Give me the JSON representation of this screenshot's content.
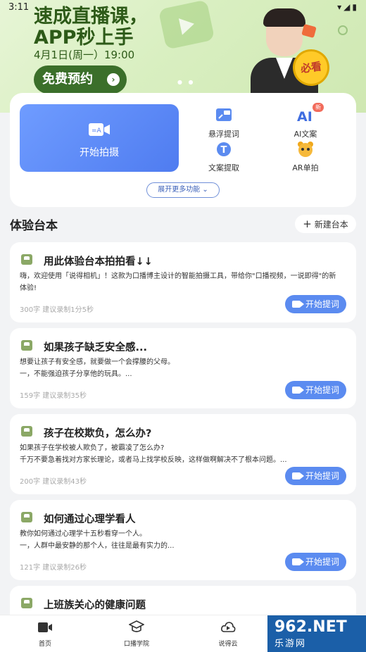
{
  "status_bar": {
    "time": "3:11"
  },
  "banner": {
    "title_line1": "速成直播课，",
    "title_line2": "APP秒上手",
    "date": "4月1日(周一）19:00",
    "reserve_label": "免费预约",
    "badge": "必看"
  },
  "tools": {
    "shoot_label": "开始拍摄",
    "floating_prompter": "悬浮提词",
    "ai_copy": "AI文案",
    "ai_badge": "新",
    "text_extract": "文案提取",
    "ar_shoot": "AR单拍",
    "expand": "展开更多功能"
  },
  "section": {
    "title": "体验台本",
    "new_button": "新建台本"
  },
  "scripts": [
    {
      "title": "用此体验台本拍拍看↓↓",
      "line1": "嗨，欢迎使用「说得相机」！这款为口播博主设计的智能拍摄工具，带给你\"口播视频，一说即得\"的新",
      "line2": "体验!",
      "meta": "300字 建议录制1分5秒",
      "button": "开始提词"
    },
    {
      "title": "如果孩子缺乏安全感...",
      "line1": "想要让孩子有安全感，就要做一个会撑腰的父母。",
      "line2": "一，不能强迫孩子分享他的玩具。...",
      "meta": "159字 建议录制35秒",
      "button": "开始提词"
    },
    {
      "title": "孩子在校欺负，怎么办?",
      "line1": "如果孩子在学校被人欺负了，被霸凌了怎么办?",
      "line2": "千万不要急着找对方家长理论，或者马上找学校反映，这样做啊解决不了根本问题。...",
      "meta": "200字 建议录制43秒",
      "button": "开始提词"
    },
    {
      "title": "如何通过心理学看人",
      "line1": "教你如何通过心理学十五秒看穿一个人。",
      "line2": "一，人群中最安静的那个人，往往是最有实力的...",
      "meta": "121字 建议录制26秒",
      "button": "开始提词"
    },
    {
      "title": "上班族关心的健康问题",
      "line1": "",
      "line2": "",
      "meta": "",
      "button": ""
    }
  ],
  "bottom_nav": {
    "home": "首页",
    "academy": "口播学院",
    "cloud": "说得云"
  },
  "watermark": {
    "brand": "962.NET",
    "sub": "乐游网"
  },
  "colors": {
    "accent": "#5b8bf0",
    "banner_green": "#2d5a18",
    "reserve_bg": "#3b6f2a"
  }
}
